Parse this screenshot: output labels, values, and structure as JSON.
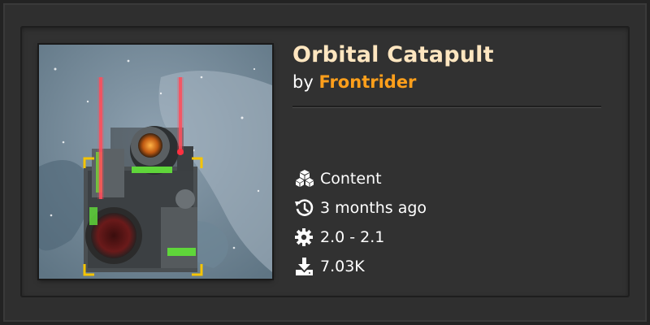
{
  "mod": {
    "title": "Orbital Catapult",
    "by_prefix": "by",
    "author": "Frontrider",
    "category": "Content",
    "updated": "3 months ago",
    "version": "2.0 - 2.1",
    "downloads": "7.03K"
  },
  "icons": {
    "category": "cubes-icon",
    "updated": "history-icon",
    "version": "gear-icon",
    "downloads": "download-icon"
  },
  "colors": {
    "title": "#ffe6c0",
    "author": "#ff9f1b",
    "text": "#ffffff",
    "background": "#313131"
  }
}
